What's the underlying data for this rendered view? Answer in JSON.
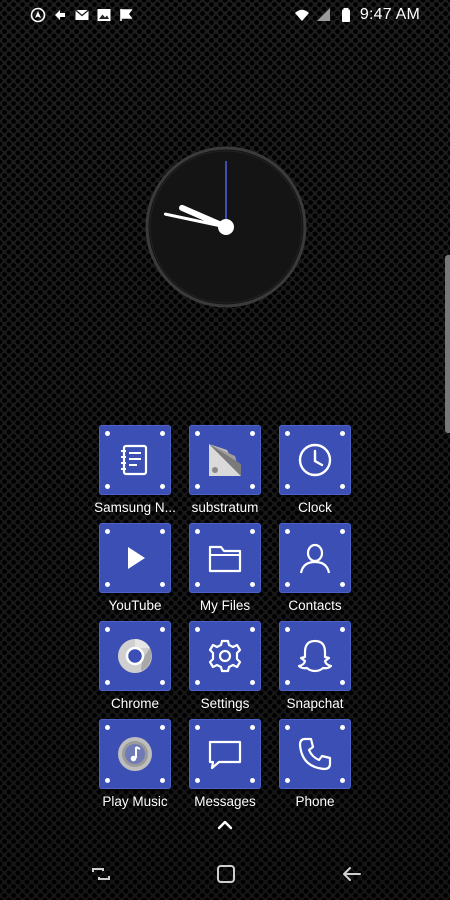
{
  "status_bar": {
    "time": "9:47 AM",
    "left_icons": [
      "android-auto-icon",
      "sync-icon",
      "email-icon",
      "image-icon",
      "flag-icon"
    ],
    "right_icons": [
      "wifi-icon",
      "signal-icon",
      "battery-icon"
    ]
  },
  "clock_widget": {
    "hours": 9,
    "minutes": 47,
    "seconds": 0
  },
  "apps": [
    {
      "label": "Samsung N...",
      "icon": "notes-icon"
    },
    {
      "label": "substratum",
      "icon": "substratum-icon"
    },
    {
      "label": "Clock",
      "icon": "clock-icon"
    },
    {
      "label": "YouTube",
      "icon": "play-icon"
    },
    {
      "label": "My Files",
      "icon": "folder-icon"
    },
    {
      "label": "Contacts",
      "icon": "contact-icon"
    },
    {
      "label": "Chrome",
      "icon": "chrome-icon"
    },
    {
      "label": "Settings",
      "icon": "gear-icon"
    },
    {
      "label": "Snapchat",
      "icon": "ghost-icon"
    },
    {
      "label": "Play Music",
      "icon": "music-icon"
    },
    {
      "label": "Messages",
      "icon": "message-icon"
    },
    {
      "label": "Phone",
      "icon": "phone-icon"
    }
  ],
  "colors": {
    "tile": "#3b4fb5",
    "second_hand": "#3b4fb5",
    "background": "#151515"
  },
  "nav_bar": {
    "buttons": [
      "recents-button",
      "home-button",
      "back-button"
    ]
  }
}
